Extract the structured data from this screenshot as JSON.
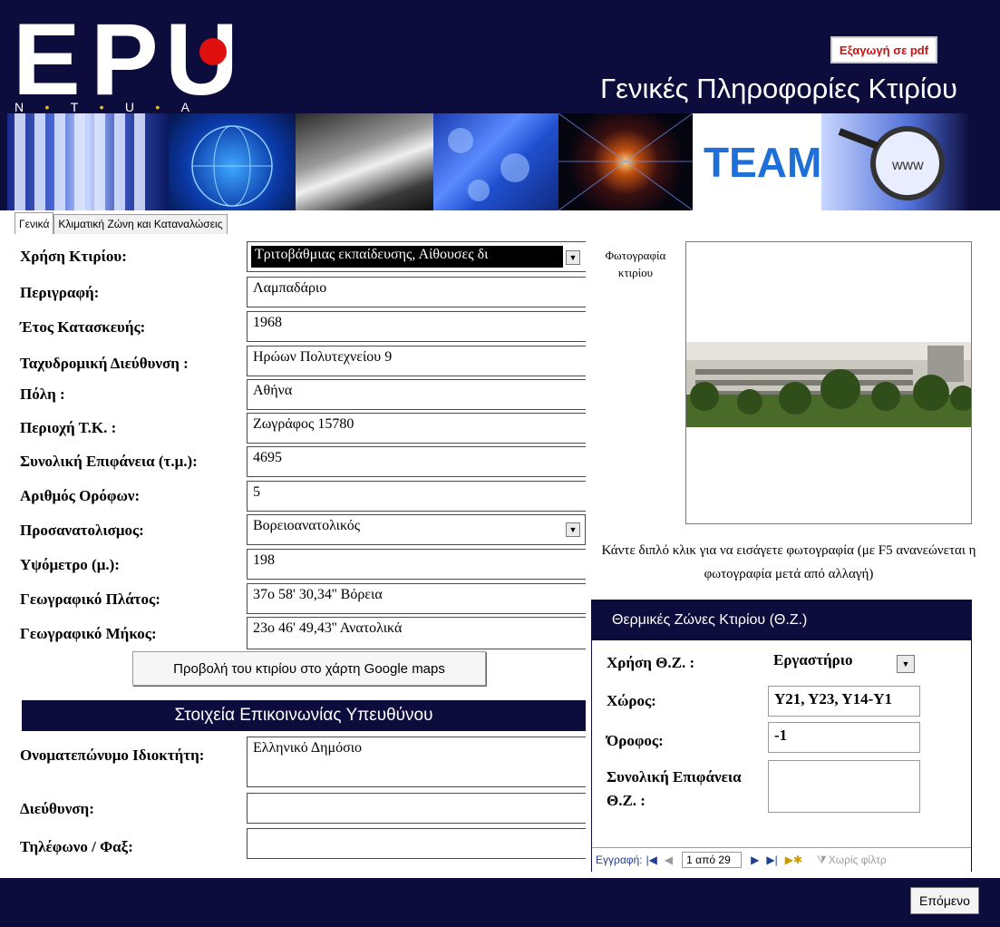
{
  "header": {
    "logo_text": "EPU",
    "logo_sub": [
      "N",
      "T",
      "U",
      "A"
    ],
    "pdf_button": "Εξαγωγή σε pdf",
    "title": "Γενικές Πληροφορίες Κτιρίου"
  },
  "tabs": [
    "Γενικά",
    "Κλιματική Ζώνη και Καταναλώσεις"
  ],
  "form": {
    "usage": {
      "label": "Χρήση Κτιρίου:",
      "value": "Τριτοβάθμιας εκπαίδευσης, Αίθουσες δι"
    },
    "description": {
      "label": "Περιγραφή:",
      "value": "Λαμπαδάριο"
    },
    "year": {
      "label": "Έτος Κατασκευής:",
      "value": "1968"
    },
    "address": {
      "label": "Ταχυδρομική Διεύθυνση :",
      "value": "Ηρώων Πολυτεχνείου 9"
    },
    "city": {
      "label": "Πόλη :",
      "value": "Αθήνα"
    },
    "area_zip": {
      "label": "Περιοχή Τ.Κ. :",
      "value": "Ζωγράφος 15780"
    },
    "total_area": {
      "label": "Συνολική Επιφάνεια (τ.μ.):",
      "value": "4695"
    },
    "floors": {
      "label": "Αριθμός Ορόφων:",
      "value": "5"
    },
    "orientation": {
      "label": "Προσανατολισμος:",
      "value": "Βορειοανατολικός"
    },
    "altitude": {
      "label": "Υψόμετρο (μ.):",
      "value": "198"
    },
    "latitude": {
      "label": "Γεωγραφικό Πλάτος:",
      "value": "37ο 58' 30,34'' Βόρεια"
    },
    "longitude": {
      "label": "Γεωγραφικό Μήκος:",
      "value": "23ο 46' 49,43'' Ανατολικά"
    }
  },
  "maps_button": "Προβολή του κτιρίου στο χάρτη  Google maps",
  "contact": {
    "header": "Στοιχεία Επικοινωνίας Υπευθύνου",
    "owner_label": "Ονοματεπώνυμο Ιδιοκτήτη:",
    "owner_value": "Ελληνικό Δημόσιο",
    "address_label": "Διεύθυνση:",
    "address_value": "",
    "phone_label": "Τηλέφωνο / Φαξ:",
    "phone_value": ""
  },
  "photo": {
    "label": "Φωτογραφία κτιρίου",
    "hint": "Κάντε διπλό κλικ για να εισάγετε φωτογραφία (με F5 ανανεώνεται η φωτογραφία μετά από αλλαγή)"
  },
  "zones": {
    "header": "Θερμικές Ζώνες Κτιρίου (Θ.Ζ.)",
    "use_label": "Χρήση Θ.Ζ. :",
    "use_value": "Εργαστήριο",
    "space_label": "Χώρος:",
    "space_value": "Υ21, Υ23, Υ14-Υ1",
    "floor_label": "Όροφος:",
    "floor_value": "-1",
    "area_label": "Συνολική Επιφάνεια Θ.Ζ. :",
    "area_value": "",
    "nav": {
      "record_label": "Εγγραφή:",
      "position": "1 από 29",
      "filter": "Χωρίς φίλτρ"
    }
  },
  "footer": {
    "next_button": "Επόμενο"
  },
  "colors": {
    "navy": "#0d0d3d",
    "accent_red": "#e01010",
    "logo_dot_yellow": "#f3c400"
  }
}
